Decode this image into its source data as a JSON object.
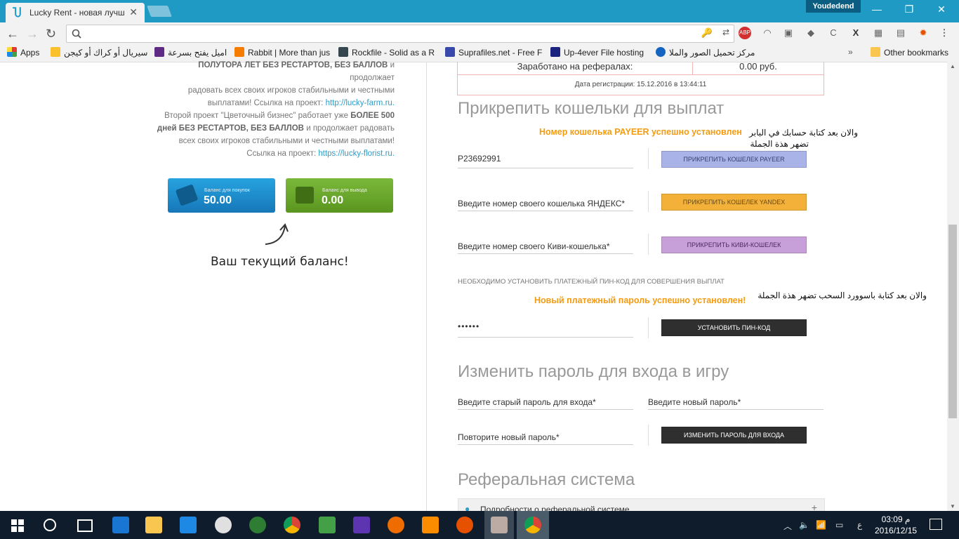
{
  "browser": {
    "tab_title": "Lucky Rent - новая лучшая",
    "profile_name": "Youdedend",
    "omnibox_text": "",
    "bookmarks": [
      {
        "label": "Apps",
        "color": "#e64a19"
      },
      {
        "label": "سيريال أو كراك أو كيجن",
        "color": "#fbc02d"
      },
      {
        "label": "اميل يفتح بسرعة",
        "color": "#5e2a84"
      },
      {
        "label": "Rabbit | More than jus",
        "color": "#f57c00"
      },
      {
        "label": "Rockfile - Solid as a R",
        "color": "#37474f"
      },
      {
        "label": "Suprafiles.net - Free F",
        "color": "#3949ab"
      },
      {
        "label": "Up-4ever File hosting",
        "color": "#1a237e"
      },
      {
        "label": "مركز تحميل الصور والملا",
        "color": "#1565c0"
      }
    ],
    "other_bookmarks": "Other bookmarks"
  },
  "left": {
    "para1_line1": "ПОЛУТОРА ЛЕТ БЕЗ РЕСТАРТОВ, БЕЗ БАЛЛОВ",
    "para1_line1_tail": " и продолжает",
    "para1_line2": "радовать всех своих игроков стабильными и честными",
    "para1_line3": "выплатами! Ссылка на проект: ",
    "para1_link": "http://lucky-farm.ru.",
    "para2_line1": "Второй проект \"Цветочный бизнес\" работает уже ",
    "para2_bold1": "БОЛЕЕ 500",
    "para2_bold2": "дней БЕЗ РЕСТАРТОВ, БЕЗ БАЛЛОВ",
    "para2_line2_tail": " и продолжает радовать",
    "para2_line3": "всех своих игроков стабильными и честными выплатами!",
    "para2_line4": "Ссылка на проект: ",
    "para2_link": "https://lucky-florist.ru.",
    "balance_buy_label": "Баланс для покупок",
    "balance_buy_value": "50.00",
    "balance_out_label": "Баланс для вывода",
    "balance_out_value": "0.00",
    "balance_caption": "Ваш текущий баланс!"
  },
  "right": {
    "referral_earned_label": "Заработано на рефералах:",
    "referral_earned_value": "0.00 руб.",
    "reg_date": "Дата регистрации: 15.12.2016 в 13:44:11",
    "wallets_title": "Прикрепить кошельки для выплат",
    "payeer_success": "Номер кошелька PAYEER успешно установлен",
    "payeer_value": "P23692991",
    "payeer_button": "ПРИКРЕПИТЬ КОШЕЛЕК PAYEER",
    "yandex_placeholder": "Введите номер своего кошелька ЯНДЕКС*",
    "yandex_button": "ПРИКРЕПИТЬ КОШЕЛЕК YANDEX",
    "qiwi_placeholder": "Введите номер своего Киви-кошелька*",
    "qiwi_button": "ПРИКРЕПИТЬ КИВИ-КОШЕЛЕК",
    "pin_notice": "НЕОБХОДИМО УСТАНОВИТЬ ПЛАТЕЖНЫЙ ПИН-КОД ДЛЯ СОВЕРШЕНИЯ ВЫПЛАТ",
    "pin_success": "Новый платежный пароль успешно установлен!",
    "pin_value": "••••••",
    "pin_button": "УСТАНОВИТЬ ПИН-КОД",
    "password_title": "Изменить пароль для входа в игру",
    "old_password": "Введите старый пароль для входа*",
    "new_password": "Введите новый пароль*",
    "repeat_password": "Повторите новый пароль*",
    "change_password_button": "ИЗМЕНИТЬ ПАРОЛЬ ДЛЯ ВХОДА",
    "referral_title": "Реферальная система",
    "referral_details": "Подробности о реферальной системе"
  },
  "annotations": {
    "note1_line1": "والان بعد كتابة حسابك في البابر",
    "note1_line2": "تضهر هذة الجملة",
    "note2": "والان بعد كتابة باسوورد السحب تضهر هذة الجملة"
  },
  "taskbar": {
    "time": "03:09 م",
    "date": "2016/12/15",
    "lang": "ع"
  },
  "colors": {
    "chrome_blue": "#1f9ac4",
    "success_orange": "#f39c12",
    "payeer_btn": "#a9b3e8",
    "yandex_btn": "#f3b13a",
    "qiwi_btn": "#c79fd9",
    "dark_btn": "#2f2f2f",
    "balance_blue": "#1e8fcf",
    "balance_green": "#6aa52a"
  }
}
